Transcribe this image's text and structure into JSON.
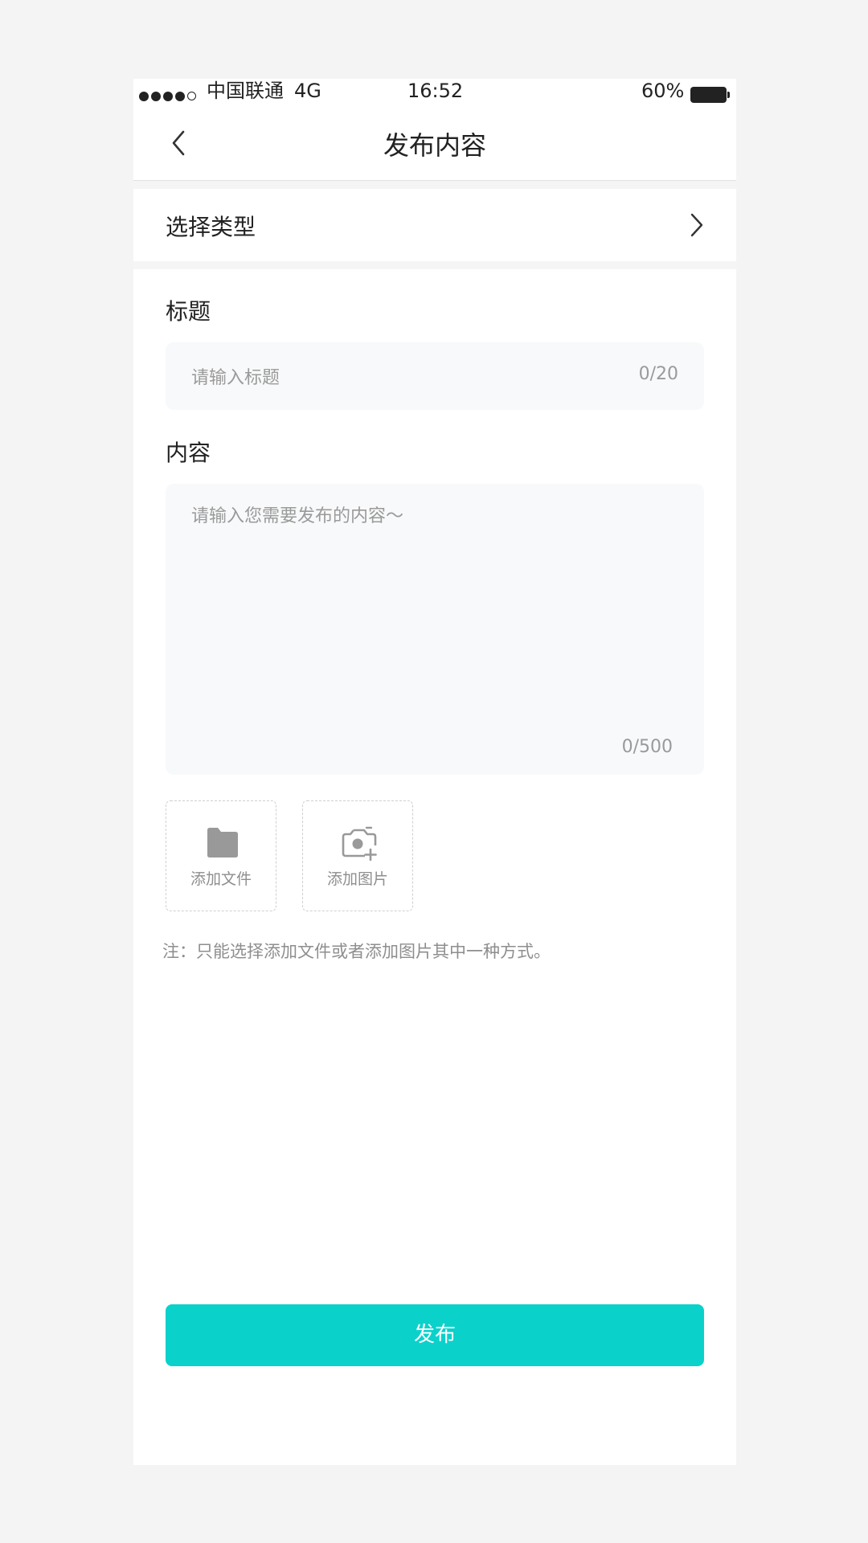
{
  "status_bar": {
    "carrier": "中国联通",
    "network": "4G",
    "time": "16:52",
    "battery": "60%"
  },
  "nav": {
    "title": "发布内容",
    "back_icon": "chevron-left-icon"
  },
  "select_type": {
    "label": "选择类型",
    "icon": "chevron-right-icon"
  },
  "form": {
    "title_label": "标题",
    "title_placeholder": "请输入标题",
    "title_count": "0/20",
    "content_label": "内容",
    "content_placeholder": "请输入您需要发布的内容～",
    "content_count": "0/500"
  },
  "attachments": {
    "add_file_label": "添加文件",
    "add_file_icon": "folder-icon",
    "add_image_label": "添加图片",
    "add_image_icon": "camera-add-icon"
  },
  "note": "注：只能选择添加文件或者添加图片其中一种方式。",
  "publish_button": "发布",
  "colors": {
    "accent": "#0bd1cb",
    "page_background": "#f4f4f5",
    "input_background": "#f8f9fa"
  }
}
